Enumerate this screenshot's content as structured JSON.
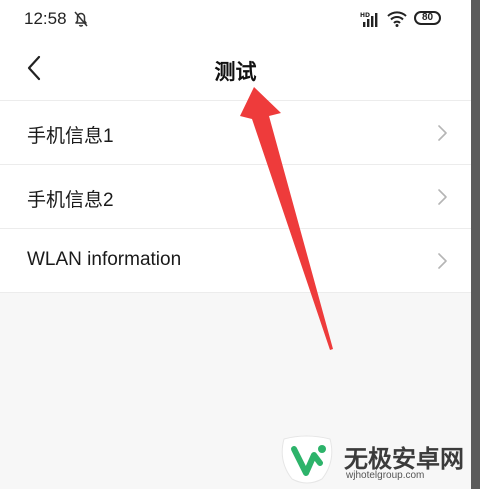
{
  "statusbar": {
    "time": "12:58",
    "battery": "80"
  },
  "header": {
    "title": "测试"
  },
  "list": {
    "items": [
      {
        "label": "手机信息1"
      },
      {
        "label": "手机信息2"
      },
      {
        "label": "WLAN information"
      }
    ]
  },
  "watermark": {
    "brand": "无极安卓网",
    "url": "wjhotelgroup.com"
  },
  "colors": {
    "annotation_arrow": "#ee3b3b",
    "watermark_green": "#2db36a"
  },
  "icons": [
    "bell-off-icon",
    "signal-icon",
    "wifi-icon",
    "battery-icon",
    "back-arrow-icon",
    "chevron-right-icon",
    "annotation-arrow",
    "watermark-logo"
  ]
}
